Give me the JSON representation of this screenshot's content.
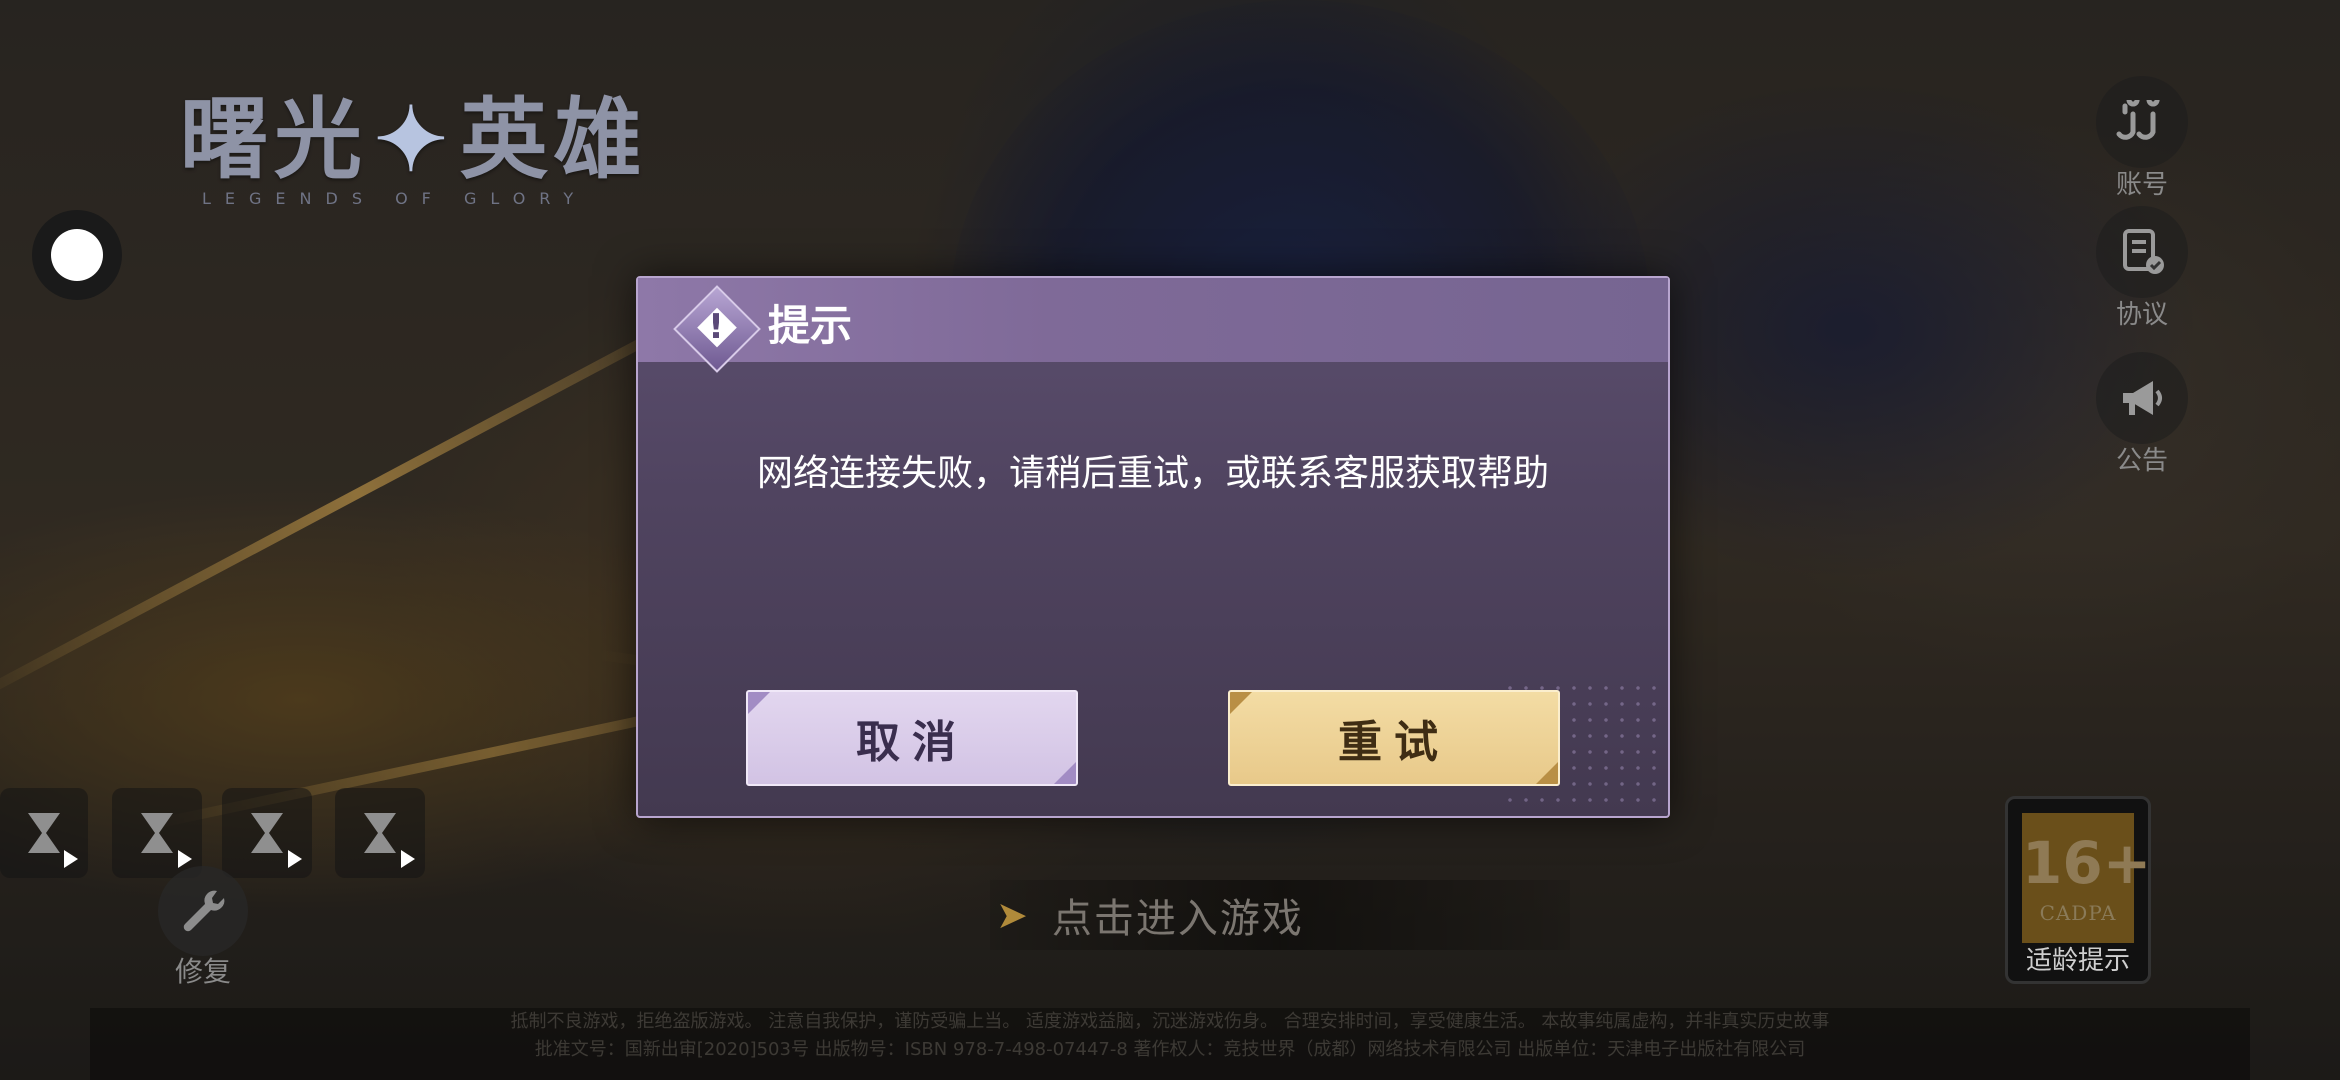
{
  "logo": {
    "cn_left": "曙光",
    "cn_right": "英雄",
    "en": "LEGENDS OF GLORY"
  },
  "side_menu": [
    {
      "label": "账号",
      "icon": "account-icon"
    },
    {
      "label": "协议",
      "icon": "agreement-icon"
    },
    {
      "label": "公告",
      "icon": "announcement-icon"
    }
  ],
  "repair": {
    "label": "修复",
    "icon": "wrench-icon"
  },
  "enter_game": {
    "label": "点击进入游戏"
  },
  "age_rating": {
    "number": "16+",
    "org": "CADPA",
    "label": "适龄提示"
  },
  "footer": {
    "line1": "抵制不良游戏，拒绝盗版游戏。 注意自我保护，谨防受骗上当。 适度游戏益脑，沉迷游戏伤身。 合理安排时间，享受健康生活。 本故事纯属虚构，并非真实历史故事",
    "line2": "批准文号：国新出审[2020]503号  出版物号：ISBN 978-7-498-07447-8  著作权人：竞技世界（成都）网络技术有限公司  出版单位：天津电子出版社有限公司"
  },
  "dialog": {
    "title": "提示",
    "message": "网络连接失败，请稍后重试，或联系客服获取帮助",
    "cancel_label": "取消",
    "retry_label": "重试"
  },
  "colors": {
    "dialog_bg": "#504460",
    "dialog_header": "#8e78a8",
    "cancel_button": "#d9cbe9",
    "retry_button": "#eed39a"
  }
}
